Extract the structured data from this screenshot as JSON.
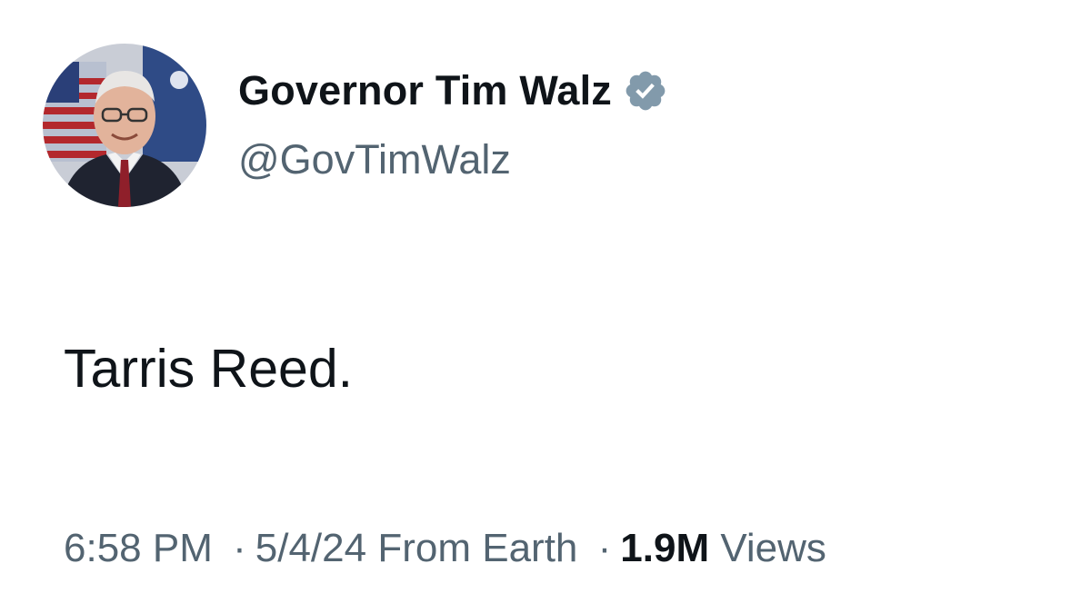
{
  "author": {
    "display_name": "Governor Tim Walz",
    "handle": "@GovTimWalz",
    "verified": true,
    "verified_icon": "verified-badge-icon",
    "verified_color": "#829aab",
    "avatar": "profile-photo"
  },
  "tweet": {
    "text": "Tarris Reed."
  },
  "meta": {
    "time": "6:58 PM",
    "separator": "·",
    "date": "5/4/24",
    "location": "From Earth",
    "views_count": "1.9M",
    "views_label": "Views"
  },
  "colors": {
    "text_primary": "#0f1419",
    "text_secondary": "#536471",
    "background": "#ffffff"
  }
}
